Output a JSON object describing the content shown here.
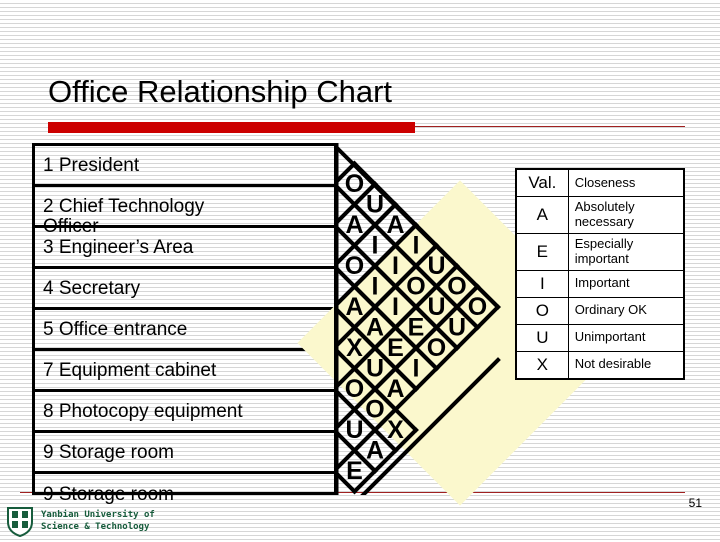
{
  "slide": {
    "title": "Office Relationship Chart",
    "page_number": "51",
    "accent_color": "#cc0000",
    "highlight_color": "#fbf8cd"
  },
  "footer": {
    "organization": "Yanbian University of\nScience & Technology",
    "logo_color": "#175c3c"
  },
  "activity_list": {
    "rows": [
      {
        "number": "1",
        "label": "President",
        "overflow": ""
      },
      {
        "number": "2",
        "label": "Chief Technology",
        "overflow": "Officer"
      },
      {
        "number": "3",
        "label": "Engineer’s Area",
        "overflow": ""
      },
      {
        "number": "4",
        "label": "Secretary",
        "overflow": ""
      },
      {
        "number": "5",
        "label": "Office entrance",
        "overflow": ""
      },
      {
        "number": "7",
        "label": "Equipment cabinet",
        "overflow": ""
      },
      {
        "number": "8",
        "label": "Photocopy equipment",
        "overflow": ""
      },
      {
        "number": "9",
        "label": "Storage room",
        "overflow": ""
      },
      {
        "number": "9",
        "label": "Storage room",
        "overflow": ""
      }
    ],
    "row_text": [
      "1  President",
      "2  Chief Technology",
      "3  Engineer’s Area",
      "4  Secretary",
      "5  Office entrance",
      "7  Equipment cabinet",
      "8 Photocopy equipment",
      "9 Storage room",
      "9 Storage room"
    ],
    "row_overflow_text": "Officer"
  },
  "chart_data": {
    "type": "table",
    "title": "Office Relationship Chart",
    "description": "Muther relationship (REL) chart: triangular matrix of closeness ratings between pairs of office activities.",
    "activities": [
      "1  President",
      "2  Chief Technology Officer",
      "3  Engineer’s Area",
      "4  Secretary",
      "5  Office entrance",
      "7  Equipment cabinet",
      "8  Photocopy equipment",
      "9  Storage room",
      "9  Storage room"
    ],
    "columns": [
      {
        "index": 1,
        "ratings": [
          "O",
          "A",
          "O",
          "A",
          "X",
          "O",
          "U",
          "E"
        ]
      },
      {
        "index": 2,
        "ratings": [
          "U",
          "I",
          "I",
          "A",
          "U",
          "O",
          "A"
        ]
      },
      {
        "index": 3,
        "ratings": [
          "A",
          "I",
          "I",
          "E",
          "A",
          "X"
        ]
      },
      {
        "index": 4,
        "ratings": [
          "I",
          "O",
          "E",
          "I"
        ]
      },
      {
        "index": 5,
        "ratings": [
          "U",
          "U",
          "O"
        ]
      },
      {
        "index": 6,
        "ratings": [
          "O",
          "U"
        ]
      },
      {
        "index": 7,
        "ratings": [
          "O"
        ]
      }
    ],
    "rating_scale": [
      "A",
      "E",
      "I",
      "O",
      "U",
      "X"
    ]
  },
  "legend": {
    "header": {
      "value": "Val.",
      "closeness": "Closeness"
    },
    "rows": [
      {
        "value": "A",
        "closeness": "Absolutely necessary"
      },
      {
        "value": "E",
        "closeness": "Especially important"
      },
      {
        "value": "I",
        "closeness": "Important"
      },
      {
        "value": "O",
        "closeness": "Ordinary OK"
      },
      {
        "value": "U",
        "closeness": "Unimportant"
      },
      {
        "value": "X",
        "closeness": "Not desirable"
      }
    ]
  }
}
